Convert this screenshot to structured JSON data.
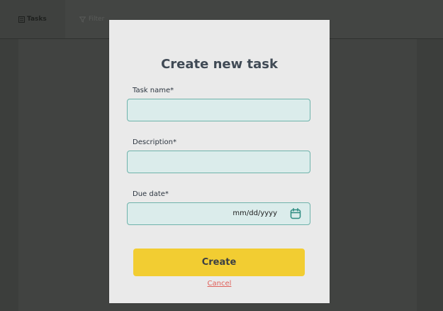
{
  "nav": {
    "tasks_label": "Tasks",
    "filter_label": "Filter",
    "tasks_icon": "list-icon",
    "filter_icon": "filter-icon"
  },
  "modal": {
    "title": "Create new task",
    "fields": {
      "task_name": {
        "label": "Task name*",
        "value": ""
      },
      "description": {
        "label": "Description*",
        "value": ""
      },
      "due_date": {
        "label": "Due date*",
        "placeholder": "mm/dd/yyyy",
        "icon": "calendar-icon"
      }
    },
    "create_label": "Create",
    "cancel_label": "Cancel"
  },
  "colors": {
    "accent_button": "#f2cd32",
    "input_background": "#dbeceb",
    "input_border": "#6fb3ab",
    "cancel_link": "#e0605a",
    "title_text": "#404a55"
  }
}
